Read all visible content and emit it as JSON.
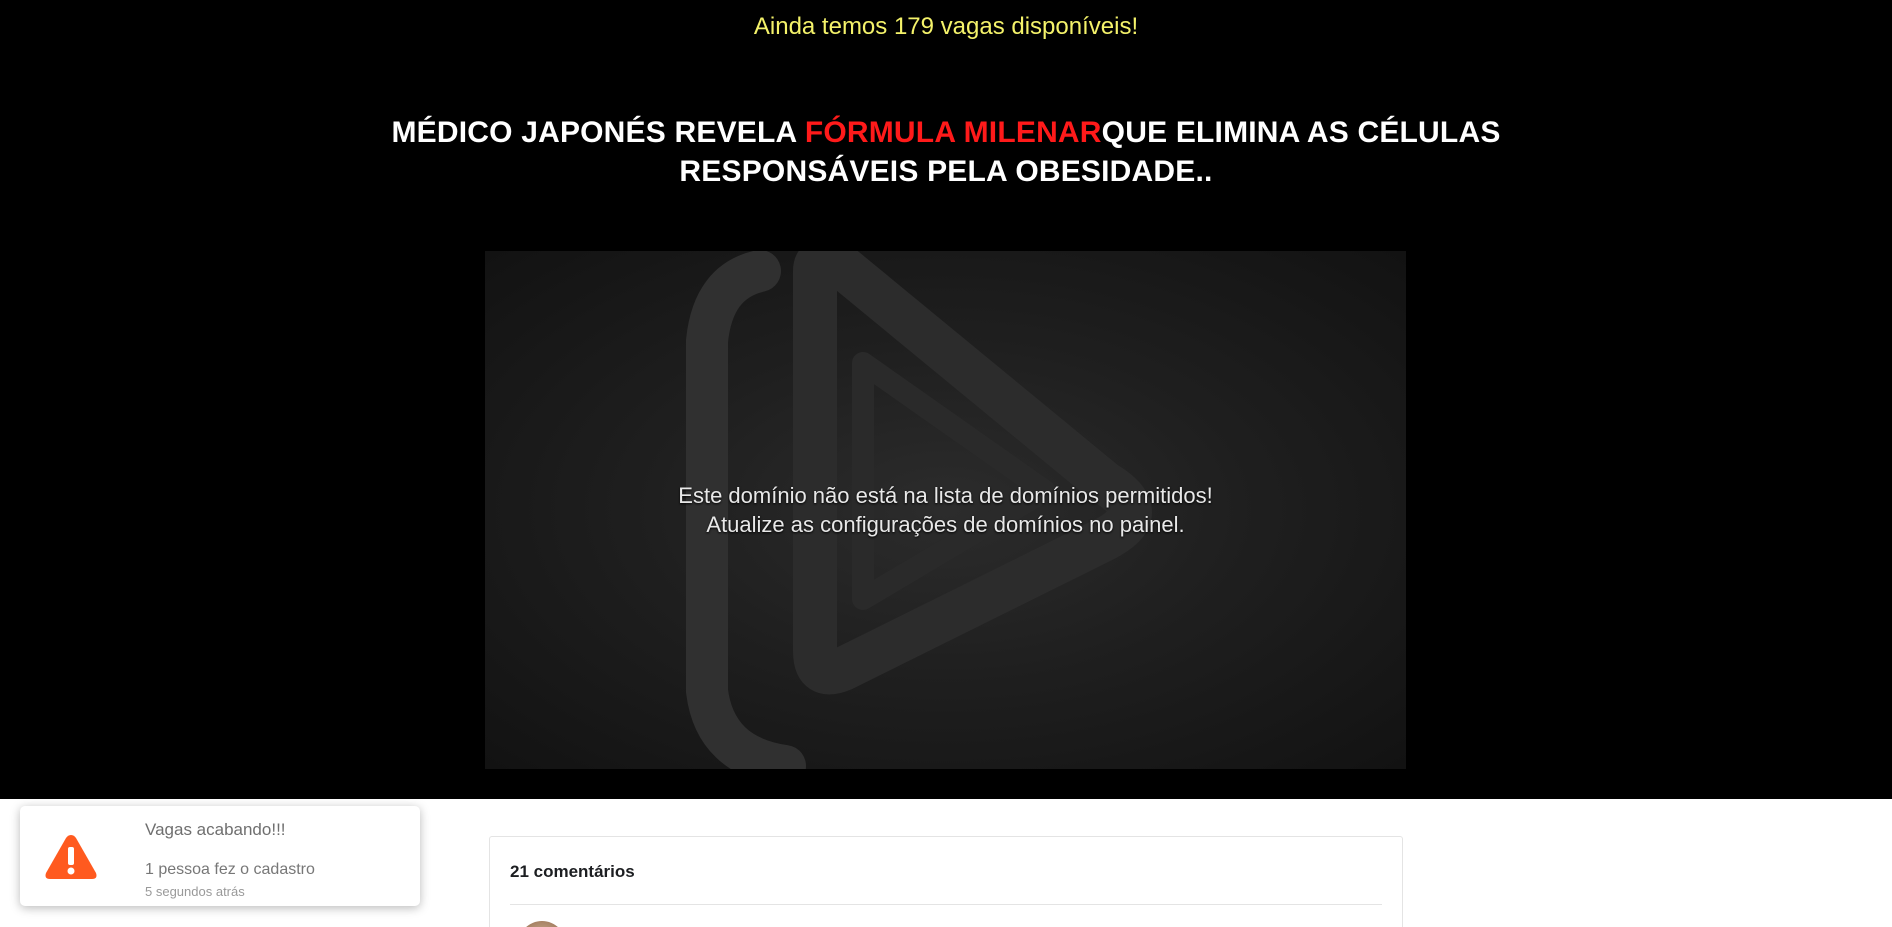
{
  "banner": {
    "vagas_text": "Ainda temos 179 vagas disponíveis!"
  },
  "headline": {
    "part1": "MÉDICO JAPONÉS REVELA ",
    "highlight": "FÓRMULA MILENAR",
    "part2": "QUE ELIMINA AS CÉLULAS RESPONSÁVEIS PELA OBESIDADE.."
  },
  "video": {
    "error_line1": "Este domínio não está na lista de domínios permitidos!",
    "error_line2": "Atualize as configurações de domínios no painel.",
    "logo_icon": "play-logo-icon"
  },
  "toast": {
    "title": "Vagas acabando!!!",
    "message": "1 pessoa fez o cadastro",
    "time": "5 segundos atrás",
    "icon": "warning-icon",
    "icon_color": "#ff5a1f"
  },
  "comments": {
    "count_label": "21 comentários"
  },
  "colors": {
    "hero_background": "#000000",
    "vagas_yellow": "#f4f26a",
    "headline_red": "#ff1a1a"
  }
}
